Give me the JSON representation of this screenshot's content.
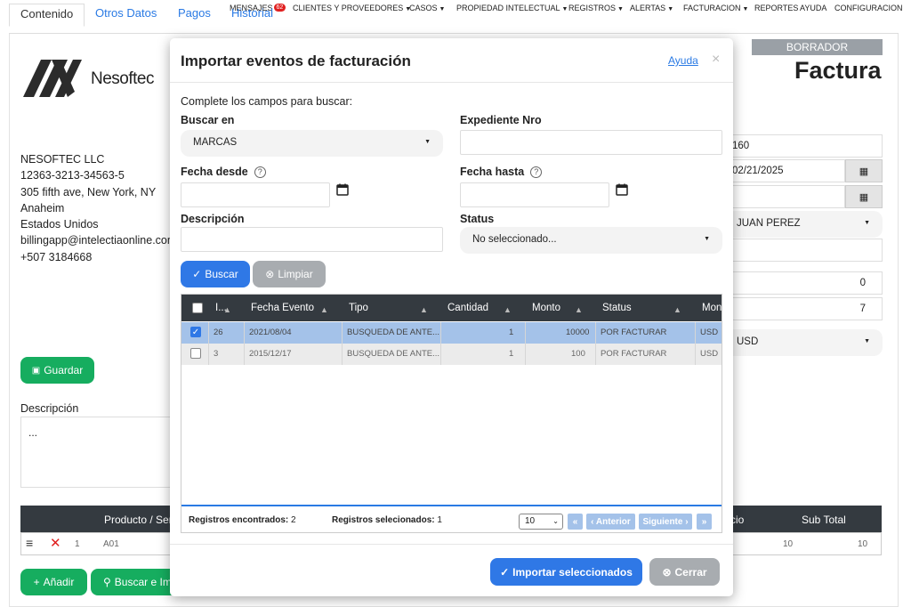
{
  "topnav": {
    "items": [
      {
        "label": "MENSAJES",
        "badge": "62",
        "caret": false
      },
      {
        "label": "CLIENTES Y PROVEEDORES",
        "caret": true
      },
      {
        "label": "CASOS",
        "caret": true
      },
      {
        "label": "PROPIEDAD INTELECTUAL",
        "caret": true
      },
      {
        "label": "REGISTROS",
        "caret": true
      },
      {
        "label": "ALERTAS",
        "caret": true
      },
      {
        "label": "FACTURACION",
        "caret": true
      },
      {
        "label": "REPORTES",
        "caret": false
      },
      {
        "label": "AYUDA",
        "caret": false
      },
      {
        "label": "CONFIGURACION",
        "caret": false
      }
    ]
  },
  "page": {
    "tabs": [
      "Contenido",
      "Otros Datos",
      "Pagos",
      "Historial"
    ],
    "logo_text": "Nesoftec",
    "company_lines": [
      "NESOFTEC LLC",
      "12363-3213-34563-5",
      "305 fifth ave, New York, NY",
      "Anaheim",
      "Estados Unidos",
      "billingapp@intelectiaonline.com",
      "+507 3184668"
    ],
    "save_label": "Guardar",
    "descripcion_label": "Descripción",
    "descripcion_value": "...",
    "status_badge": "BORRADOR",
    "doc_title": "Factura",
    "right_fields": {
      "number": "160",
      "date": "02/21/2025",
      "date2": "",
      "user": "JUAN PEREZ",
      "blank": "",
      "zero": "0",
      "seven": "7",
      "currency": "USD"
    },
    "grid": {
      "headers": [
        "Producto / Ser",
        "cio",
        "Sub Total"
      ],
      "row": {
        "num": "1",
        "code": "A01",
        "price": "10",
        "subtotal": "10"
      }
    },
    "add_label": "Añadir",
    "search_import_label": "Buscar e Im"
  },
  "modal": {
    "title": "Importar eventos de facturación",
    "help_link": "Ayuda",
    "close": "×",
    "intro": "Complete los campos para buscar:",
    "buscar_en_label": "Buscar en",
    "buscar_en_value": "MARCAS",
    "expediente_label": "Expediente Nro",
    "expediente_value": "",
    "fecha_desde_label": "Fecha desde",
    "fecha_hasta_label": "Fecha hasta",
    "descripcion_label": "Descripción",
    "status_label": "Status",
    "status_value": "No seleccionado...",
    "help_glyph": "?",
    "buscar_label": "Buscar",
    "limpiar_label": "Limpiar",
    "table": {
      "headers": [
        "I...",
        "Fecha Evento",
        "Tipo",
        "Cantidad",
        "Monto",
        "Status",
        "Mon"
      ],
      "rows": [
        {
          "selected": true,
          "id": "26",
          "fecha": "2021/08/04",
          "tipo": "BUSQUEDA DE ANTE...",
          "cantidad": "1",
          "monto": "10000",
          "status": "POR FACTURAR",
          "moneda": "USD"
        },
        {
          "selected": false,
          "id": "3",
          "fecha": "2015/12/17",
          "tipo": "BUSQUEDA DE ANTE...",
          "cantidad": "1",
          "monto": "100",
          "status": "POR FACTURAR",
          "moneda": "USD"
        }
      ],
      "found_label": "Registros encontrados:",
      "found_count": "2",
      "selected_label": "Registros selecionados:",
      "selected_count": "1",
      "page_size": "10",
      "first": "«",
      "prev": "‹ Anterior",
      "next": "Siguiente ›",
      "last": "»"
    },
    "import_label": "Importar seleccionados",
    "cerrar_label": "Cerrar"
  },
  "colors": {
    "accent_blue": "#2f78e6",
    "green": "#16ad5f",
    "dark_header": "#343a40",
    "selected_row": "#a4c2e9"
  }
}
